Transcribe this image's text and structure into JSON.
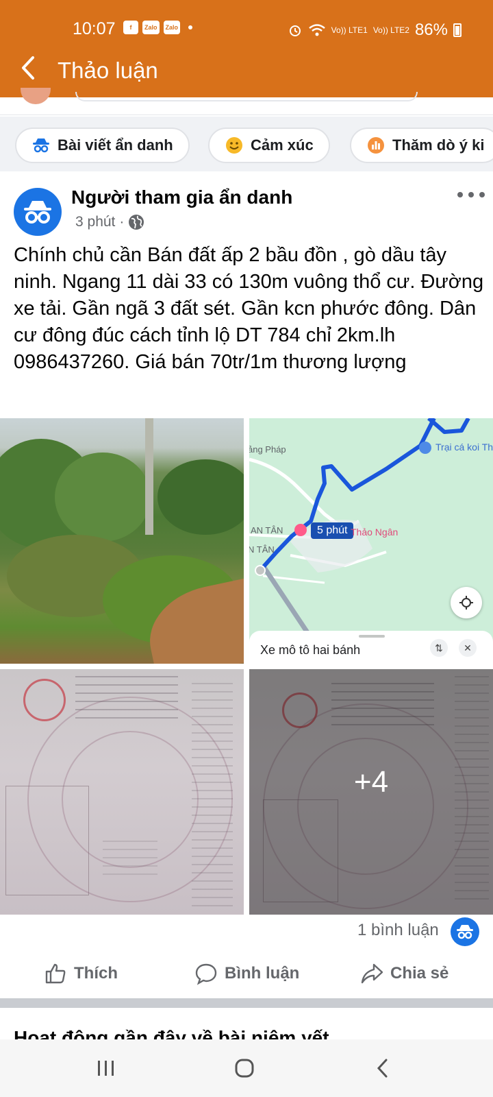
{
  "status_bar": {
    "time": "10:07",
    "battery": "86%",
    "left_badges": [
      "f",
      "Zalo",
      "Zalo"
    ],
    "sim1": "Vo)) LTE1",
    "sim2": "Vo)) LTE2"
  },
  "appbar": {
    "title": "Thảo luận",
    "color": "#d8711a"
  },
  "chips": [
    {
      "label": "Bài viết ẩn danh",
      "icon": "incognito-icon"
    },
    {
      "label": "Cảm xúc",
      "icon": "smiley-icon"
    },
    {
      "label": "Thăm dò ý ki",
      "icon": "poll-icon"
    }
  ],
  "post": {
    "author": "Người tham gia ẩn danh",
    "time": "3 phút",
    "separator": "·",
    "privacy_icon": "globe-icon",
    "text": "Chính chủ cần Bán đất ấp 2 bầu đồn , gò dầu tây ninh. Ngang 11 dài 33 có 130m vuông thổ cư. Đường xe tải. Gần ngã 3 đất sét. Gần kcn phước đông. Dân cư đông đúc cách tỉnh lộ DT 784 chỉ 2km.lh 0986437260. Giá bán 70tr/1m thương lượng",
    "map": {
      "labels": [
        "ảng Pháp",
        "AN TÂN",
        "N TÂN"
      ],
      "poi_1": "Trại cá koi Th",
      "poi_2": "Thảo Ngân",
      "eta": "5 phút",
      "travel_mode": "Xe mô tô hai bánh"
    },
    "more_photos": "+4",
    "comment_count": "1 bình luận",
    "actions": {
      "like": "Thích",
      "comment": "Bình luận",
      "share": "Chia sẻ"
    }
  },
  "recent_activity_title": "Hoạt động gần đây về bài niêm yết",
  "colors": {
    "accent": "#d8711a",
    "blue": "#1b74e4",
    "route": "#1a56db",
    "secondary_text": "#65676b"
  }
}
